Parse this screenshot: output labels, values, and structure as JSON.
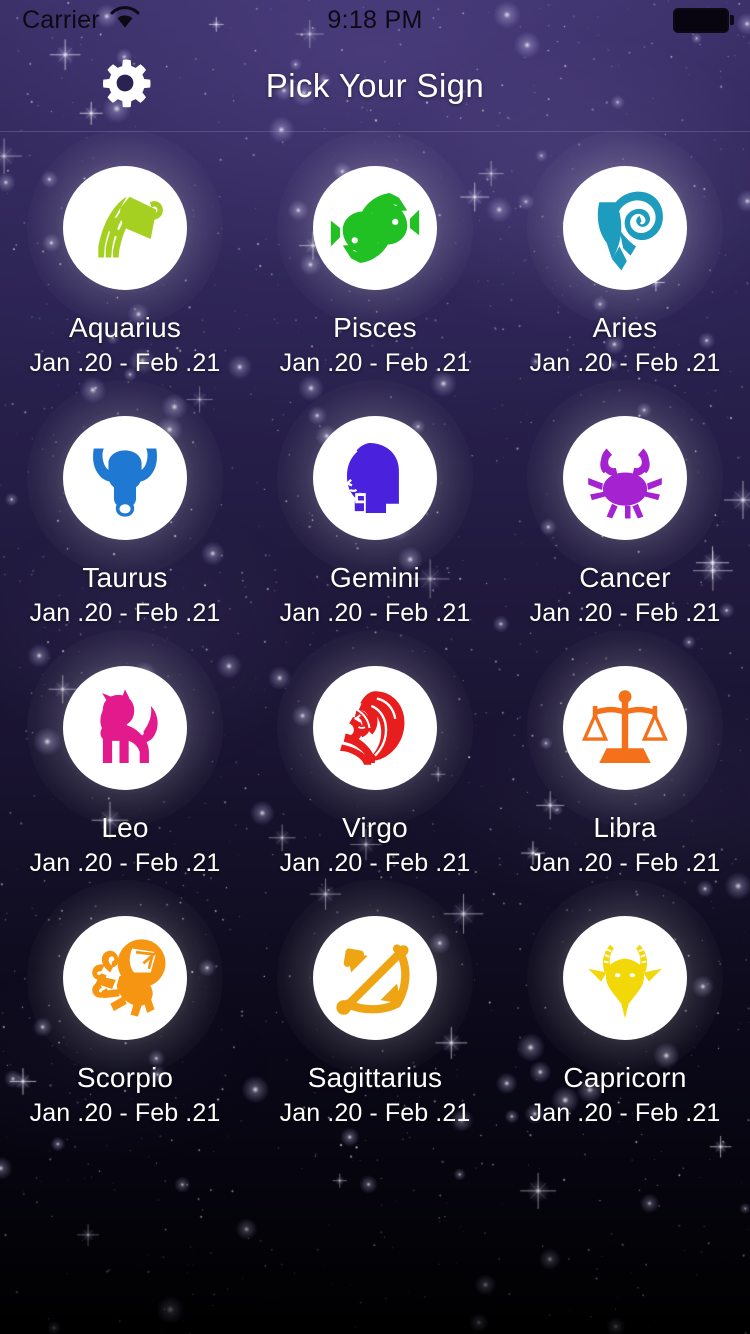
{
  "status_bar": {
    "carrier": "Carrier",
    "wifi_icon": "wifi-icon",
    "time": "9:18 PM",
    "battery_icon": "battery-full-icon"
  },
  "nav_bar": {
    "settings_icon": "gear-icon",
    "title": "Pick Your Sign"
  },
  "colors": {
    "aquarius": "#a5d022",
    "pisces": "#22c123",
    "aries": "#1d9cbe",
    "taurus": "#1f78d1",
    "gemini": "#4a22dd",
    "cancer": "#a522d1",
    "leo": "#e31a8c",
    "virgo": "#e81d1d",
    "libra": "#f4701a",
    "scorpio": "#f59511",
    "sagittarius": "#efa513",
    "capricorn": "#f2d808",
    "disc_background": "#ffffff",
    "text": "#ffffff",
    "status_text": "#0d0a14"
  },
  "grid": {
    "columns": 3,
    "rows": 4,
    "signs": [
      {
        "name": "Aquarius",
        "dates": "Jan .20 - Feb .21",
        "icon": "aquarius-water-bearer-icon",
        "color_key": "aquarius"
      },
      {
        "name": "Pisces",
        "dates": "Jan .20 - Feb .21",
        "icon": "pisces-two-fish-icon",
        "color_key": "pisces"
      },
      {
        "name": "Aries",
        "dates": "Jan .20 - Feb .21",
        "icon": "aries-ram-icon",
        "color_key": "aries"
      },
      {
        "name": "Taurus",
        "dates": "Jan .20 - Feb .21",
        "icon": "taurus-bull-icon",
        "color_key": "taurus"
      },
      {
        "name": "Gemini",
        "dates": "Jan .20 - Feb .21",
        "icon": "gemini-twins-icon",
        "color_key": "gemini"
      },
      {
        "name": "Cancer",
        "dates": "Jan .20 - Feb .21",
        "icon": "cancer-crab-icon",
        "color_key": "cancer"
      },
      {
        "name": "Leo",
        "dates": "Jan .20 - Feb .21",
        "icon": "leo-lion-icon",
        "color_key": "leo"
      },
      {
        "name": "Virgo",
        "dates": "Jan .20 - Feb .21",
        "icon": "virgo-maiden-icon",
        "color_key": "virgo"
      },
      {
        "name": "Libra",
        "dates": "Jan .20 - Feb .21",
        "icon": "libra-scales-icon",
        "color_key": "libra"
      },
      {
        "name": "Scorpio",
        "dates": "Jan .20 - Feb .21",
        "icon": "scorpio-scorpion-icon",
        "color_key": "scorpio"
      },
      {
        "name": "Sagittarius",
        "dates": "Jan .20 - Feb .21",
        "icon": "sagittarius-bow-arrow-icon",
        "color_key": "sagittarius"
      },
      {
        "name": "Capricorn",
        "dates": "Jan .20 - Feb .21",
        "icon": "capricorn-goat-icon",
        "color_key": "capricorn"
      }
    ]
  }
}
